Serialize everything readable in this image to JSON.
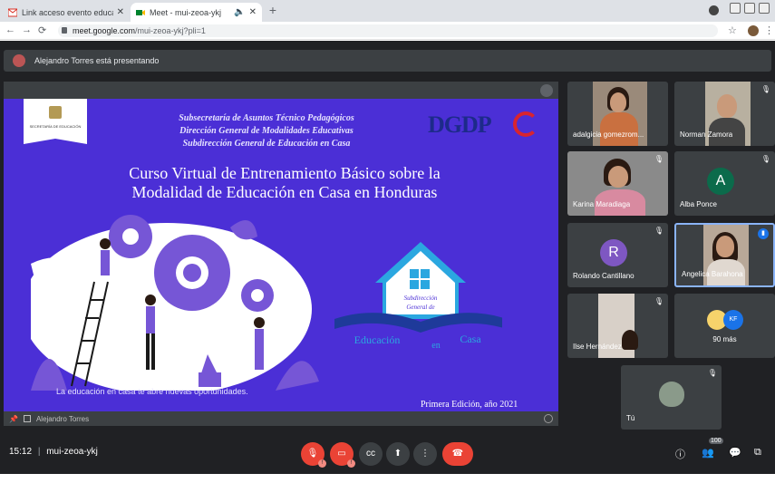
{
  "browser": {
    "tabs": [
      {
        "title": "Link acceso evento educación en"
      },
      {
        "title": "Meet - mui-zeoa-ykj"
      }
    ],
    "url_host": "meet.google.com",
    "url_path": "/mui-zeoa-ykj?pli=1",
    "new_tab": "+",
    "close": "✕"
  },
  "meet": {
    "presenting_banner": "Alejandro Torres está presentando",
    "stage_footer_name": "Alejandro Torres",
    "clock": "15:12",
    "meeting_code": "mui-zeoa-ykj",
    "participant_count": "100",
    "more_label": "90 más",
    "more_avatar": "KF",
    "accent": "#8ab4f8",
    "end_color": "#ea4335"
  },
  "slide": {
    "logo_text": "SECRETARÍA DE EDUCACIÓN",
    "sub_lines": [
      "Subsecretaría de Asuntos Técnico Pedagógicos",
      "Dirección General de Modalidades Educativas",
      "Subdirección General de Educación en Casa"
    ],
    "dgdp": "DGDP",
    "title_line1": "Curso Virtual de Entrenamiento Básico sobre la",
    "title_line2": "Modalidad de Educación en Casa en Honduras",
    "casa_sub1": "Subdirección",
    "casa_sub2": "General de",
    "casa_main1": "Educación",
    "casa_main2": "en",
    "casa_main3": "Casa",
    "tagline": "La educación en casa te abre nuevas oportunidades.",
    "edition": "Primera Edición, año 2021",
    "bg": "#4b2fd6"
  },
  "participants": [
    {
      "name": "adalgicia gomezrom...",
      "type": "video"
    },
    {
      "name": "Norman Zamora",
      "type": "video"
    },
    {
      "name": "Karina Maradiaga",
      "type": "video"
    },
    {
      "name": "Alba Ponce",
      "type": "letter",
      "letter": "A",
      "color": "#0b6b4b"
    },
    {
      "name": "Rolando Cantillano",
      "type": "letter",
      "letter": "R",
      "color": "#7e57c2"
    },
    {
      "name": "Angelica Barahona",
      "type": "video",
      "active": true
    },
    {
      "name": "Ilse Hernández",
      "type": "video"
    },
    {
      "name": "Tú",
      "type": "video"
    }
  ]
}
